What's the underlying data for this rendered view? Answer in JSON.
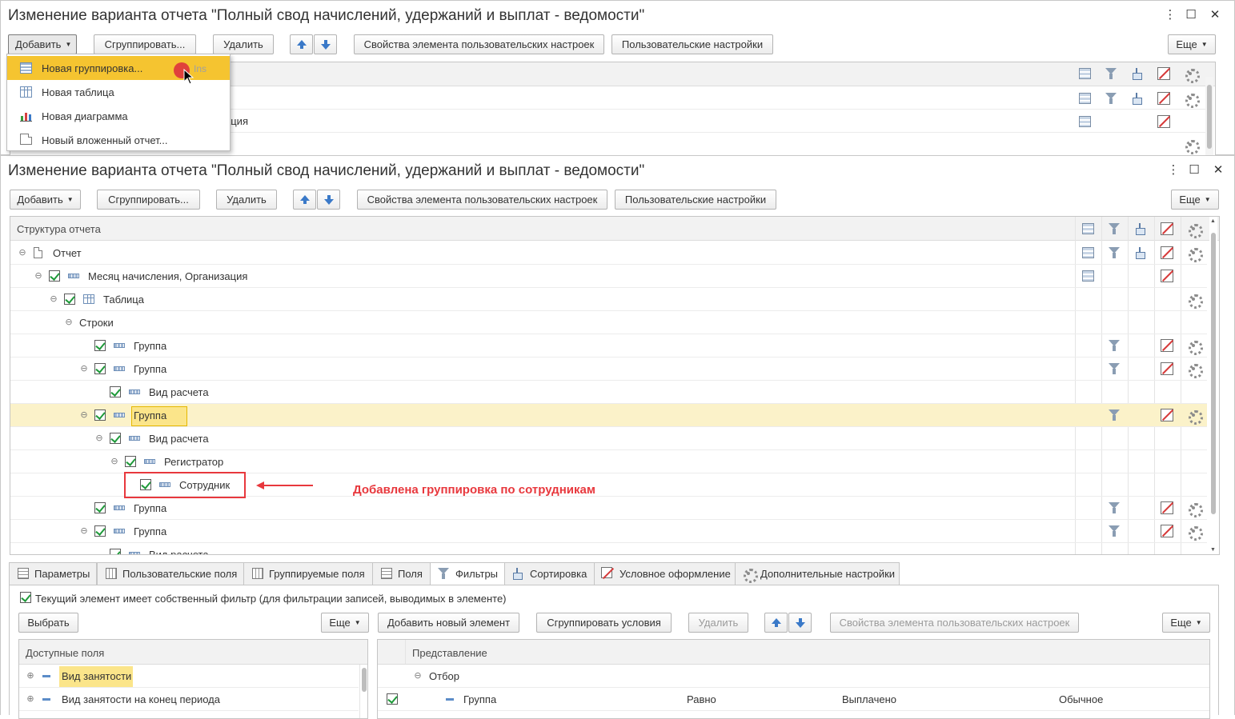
{
  "window_title": "Изменение варианта отчета \"Полный свод начислений, удержаний и выплат - ведомости\"",
  "window_controls": {
    "more": "⋮",
    "minimize": "—",
    "maximize": "☐",
    "close": "✕"
  },
  "toolbar": {
    "add": "Добавить",
    "group": "Сгруппировать...",
    "delete": "Удалить",
    "props": "Свойства элемента пользовательских настроек",
    "user_settings": "Пользовательские настройки",
    "more": "Еще"
  },
  "add_menu": {
    "items": [
      {
        "label": "Новая группировка...",
        "shortcut": "Ins"
      },
      {
        "label": "Новая таблица",
        "shortcut": ""
      },
      {
        "label": "Новая диаграмма",
        "shortcut": ""
      },
      {
        "label": "Новый вложенный отчет...",
        "shortcut": ""
      }
    ]
  },
  "back_tree": {
    "row2_fragment": "ация"
  },
  "tree": {
    "header": "Структура отчета",
    "rows": [
      {
        "text": "Отчет"
      },
      {
        "text": "Месяц начисления, Организация"
      },
      {
        "text": "Таблица"
      },
      {
        "text": "Строки"
      },
      {
        "text": "Группа"
      },
      {
        "text": "Группа"
      },
      {
        "text": "Вид расчета"
      },
      {
        "text": "Группа"
      },
      {
        "text": "Вид расчета"
      },
      {
        "text": "Регистратор"
      },
      {
        "text": "Сотрудник"
      },
      {
        "text": "Группа"
      },
      {
        "text": "Группа"
      },
      {
        "text": "Вид расчета"
      }
    ]
  },
  "annotation": "Добавлена группировка по сотрудникам",
  "tabs": [
    "Параметры",
    "Пользовательские поля",
    "Группируемые поля",
    "Поля",
    "Фильтры",
    "Сортировка",
    "Условное оформление",
    "Дополнительные настройки"
  ],
  "filters": {
    "own_filter_label": "Текущий элемент имеет собственный фильтр (для фильтрации записей, выводимых в элементе)",
    "choose": "Выбрать",
    "more": "Еще",
    "add_new": "Добавить новый элемент",
    "group_conditions": "Сгруппировать условия",
    "delete": "Удалить",
    "props": "Свойства элемента пользовательских настроек",
    "more2": "Еще",
    "available_header": "Доступные поля",
    "available": [
      "Вид занятости",
      "Вид занятости на конец периода"
    ],
    "repr_header": "Представление",
    "repr_rows": [
      {
        "text": "Отбор"
      },
      {
        "text": "Группа",
        "cond": "Равно",
        "value": "Выплачено",
        "mode": "Обычное"
      }
    ]
  },
  "colors": {
    "accent_yellow": "#f5c430",
    "selection": "#fbf2c9",
    "annotation_red": "#e8383d",
    "check_green": "#1f9a3a"
  }
}
